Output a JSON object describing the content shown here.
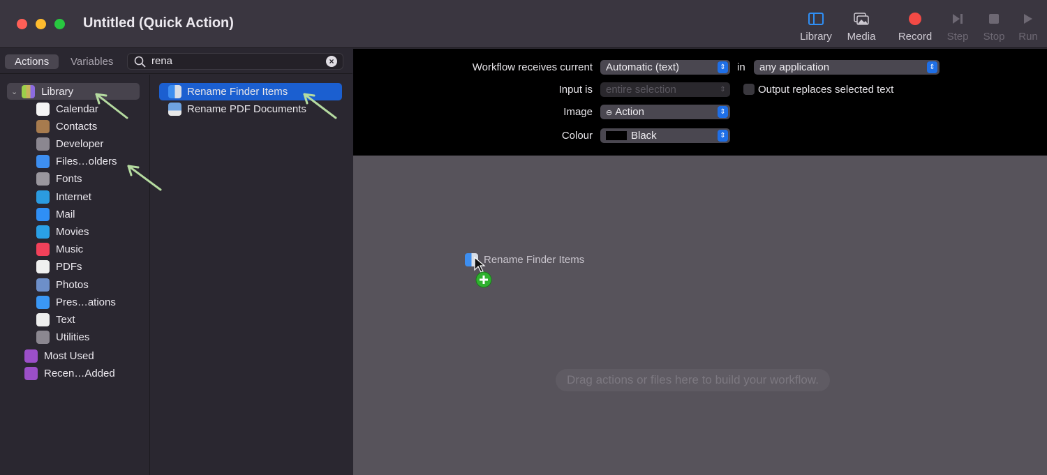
{
  "window": {
    "title": "Untitled (Quick Action)"
  },
  "toolbar": {
    "items": [
      {
        "label": "Library",
        "icon": "sidebar-icon"
      },
      {
        "label": "Media",
        "icon": "photos-icon"
      },
      {
        "label": "Record",
        "icon": "record-icon"
      },
      {
        "label": "Step",
        "icon": "step-icon"
      },
      {
        "label": "Stop",
        "icon": "stop-icon"
      },
      {
        "label": "Run",
        "icon": "play-icon"
      }
    ]
  },
  "tabs": {
    "actions": "Actions",
    "variables": "Variables"
  },
  "search": {
    "value": "rena"
  },
  "library": {
    "root": "Library",
    "items": [
      {
        "label": "Calendar",
        "color": "#f4f4f4"
      },
      {
        "label": "Contacts",
        "color": "#a77b4e"
      },
      {
        "label": "Developer",
        "color": "#8b8790"
      },
      {
        "label": "Files…olders",
        "color": "#3d8ef0"
      },
      {
        "label": "Fonts",
        "color": "#9a979e"
      },
      {
        "label": "Internet",
        "color": "#2b9be0"
      },
      {
        "label": "Mail",
        "color": "#2f8ff5"
      },
      {
        "label": "Movies",
        "color": "#2aa0e6"
      },
      {
        "label": "Music",
        "color": "#f2415a"
      },
      {
        "label": "PDFs",
        "color": "#f0f0f0"
      },
      {
        "label": "Photos",
        "color": "#6d8fc9"
      },
      {
        "label": "Pres…ations",
        "color": "#3a97f5"
      },
      {
        "label": "Text",
        "color": "#eeeeee"
      },
      {
        "label": "Utilities",
        "color": "#8b8790"
      }
    ],
    "groups": [
      {
        "label": "Most Used"
      },
      {
        "label": "Recen…Added"
      }
    ]
  },
  "actions": [
    {
      "label": "Rename Finder Items",
      "selected": true
    },
    {
      "label": "Rename PDF Documents",
      "selected": false
    }
  ],
  "config": {
    "receives_label": "Workflow receives current",
    "receives_value": "Automatic (text)",
    "in_label": "in",
    "app_value": "any application",
    "input_label": "Input is",
    "input_value": "entire selection",
    "output_checkbox": "Output replaces selected text",
    "output_checked": false,
    "image_label": "Image",
    "image_value": "Action",
    "colour_label": "Colour",
    "colour_value": "Black"
  },
  "canvas": {
    "dragging": "Rename Finder Items",
    "hint": "Drag actions or files here to build your workflow."
  },
  "colors": {
    "accent": "#1b5fd0",
    "annotation_arrow": "#b5dba0"
  }
}
